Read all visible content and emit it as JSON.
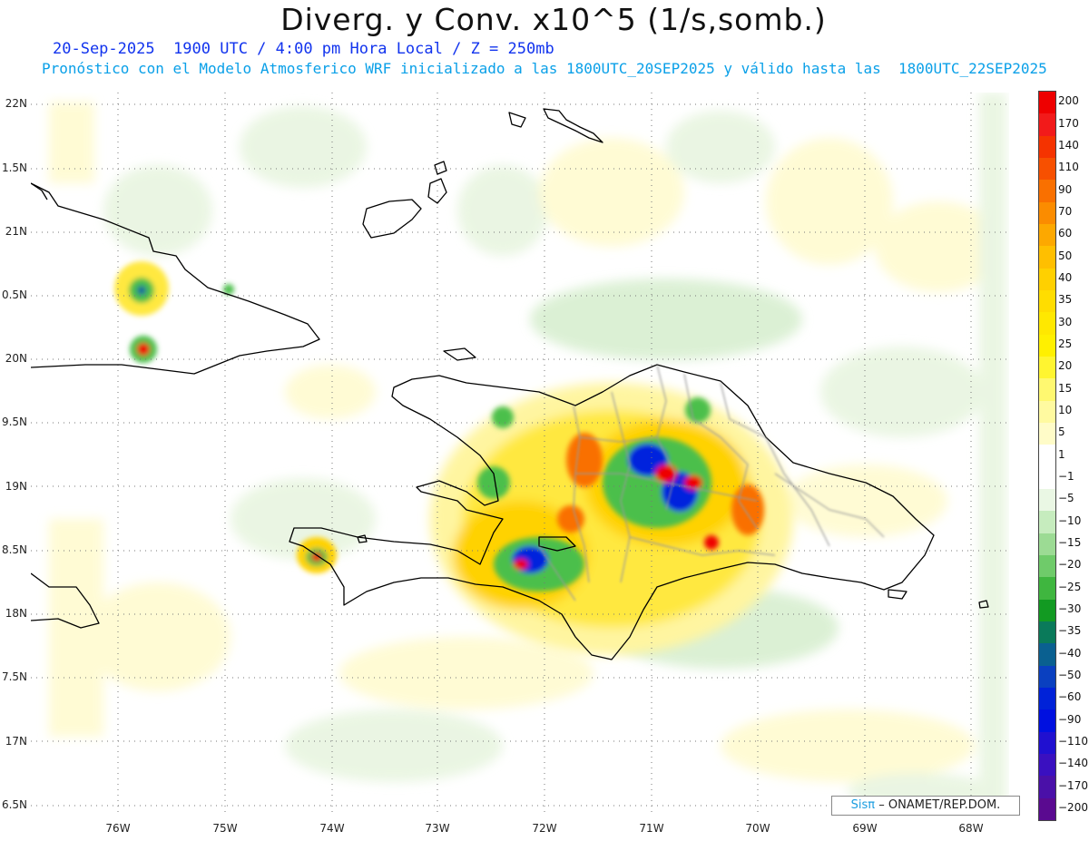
{
  "title": "Diverg. y Conv. x10^5 (1/s,somb.)",
  "subtitle_line1": "20-Sep-2025  1900 UTC / 4:00 pm Hora Local / Z = 250mb",
  "subtitle_line2": "Pronóstico con el Modelo Atmosferico WRF inicializado a las 1800UTC_20SEP2025 y válido hasta las  1800UTC_22SEP2025",
  "lat_labels": [
    "22N",
    "1.5N",
    "21N",
    "0.5N",
    "20N",
    "9.5N",
    "19N",
    "8.5N",
    "18N",
    "7.5N",
    "17N",
    "6.5N"
  ],
  "lon_labels": [
    "76W",
    "75W",
    "74W",
    "73W",
    "72W",
    "71W",
    "70W",
    "69W",
    "68W"
  ],
  "colorbar": {
    "labels": [
      "200",
      "170",
      "140",
      "110",
      "90",
      "70",
      "60",
      "50",
      "40",
      "35",
      "30",
      "25",
      "20",
      "15",
      "10",
      "5",
      "1",
      "−1",
      "−5",
      "−10",
      "−15",
      "−20",
      "−25",
      "−30",
      "−35",
      "−40",
      "−50",
      "−60",
      "−90",
      "−110",
      "−140",
      "−170",
      "−200"
    ],
    "colors": [
      "#ee0000",
      "#f21a1a",
      "#f53300",
      "#f75000",
      "#f97000",
      "#fb8c00",
      "#fda800",
      "#ffbf00",
      "#ffd000",
      "#ffdd00",
      "#ffe800",
      "#fff000",
      "#fff530",
      "#fff870",
      "#fffaa0",
      "#fffcc8",
      "#ffffff",
      "#ffffff",
      "#eaf7e4",
      "#c6ecbe",
      "#9cdb94",
      "#6fcb6a",
      "#3fb63f",
      "#129a22",
      "#0a7a5a",
      "#0a6090",
      "#0a40c0",
      "#0022d8",
      "#0010e0",
      "#2010d0",
      "#3a10c0",
      "#4a10a8",
      "#5a0a90"
    ]
  },
  "credit": {
    "brand": "Sisπ",
    "text": "– ONAMET/REP.DOM."
  },
  "colors": {
    "coast": "#000000",
    "provinces": "#999999",
    "grid": "#777777"
  }
}
